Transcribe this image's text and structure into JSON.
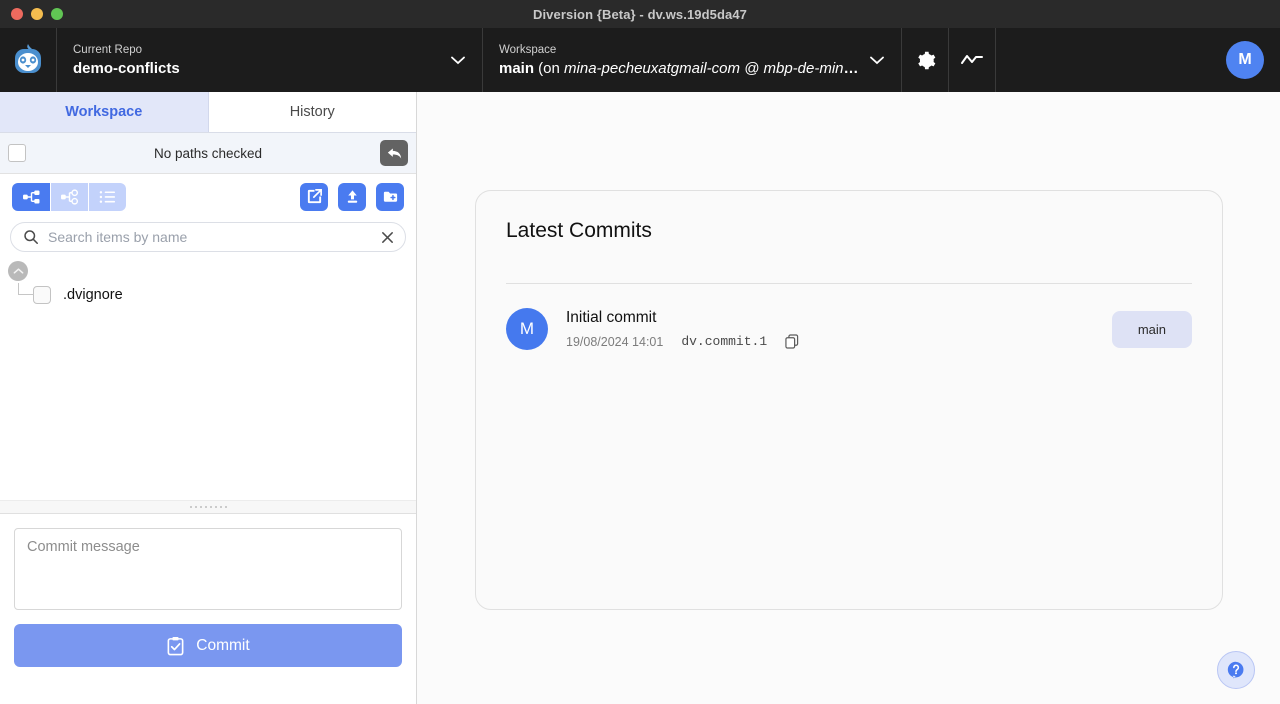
{
  "window": {
    "title": "Diversion {Beta} - dv.ws.19d5da47",
    "traffic_lights": [
      "close",
      "minimize",
      "maximize"
    ]
  },
  "topnav": {
    "logo_icon": "sloth-logo-icon",
    "repo": {
      "label": "Current Repo",
      "value": "demo-conflicts",
      "chevron_icon": "chevron-down-icon"
    },
    "workspace": {
      "label": "Workspace",
      "value_bold": "main",
      "value_rest_prefix": " (on ",
      "value_italic": "mina-pecheuxatgmail-com @ mbp-de-mina-ho",
      "value_rest_suffix": ")",
      "chevron_icon": "chevron-down-icon"
    },
    "settings_icon": "gear-icon",
    "activity_icon": "activity-line-icon",
    "avatar_initial": "M",
    "avatar_color": "#4f83f1"
  },
  "sidebar": {
    "tabs": [
      {
        "label": "Workspace",
        "active": true
      },
      {
        "label": "History",
        "active": false
      }
    ],
    "paths_bar": {
      "checkbox_checked": false,
      "status_text": "No paths checked",
      "revert_icon": "revert-arrow-icon"
    },
    "toolbar": {
      "view_modes": [
        {
          "name": "tree-view",
          "icon": "tree-expanded-icon",
          "active": true
        },
        {
          "name": "tree-changes-view",
          "icon": "tree-changes-icon",
          "active": false
        },
        {
          "name": "list-view",
          "icon": "list-icon",
          "active": false
        }
      ],
      "actions": [
        {
          "name": "open-external-button",
          "icon": "external-link-icon"
        },
        {
          "name": "upload-button",
          "icon": "upload-icon"
        },
        {
          "name": "new-folder-button",
          "icon": "new-folder-icon"
        }
      ]
    },
    "search": {
      "placeholder": "Search items by name",
      "value": "",
      "search_icon": "search-icon",
      "clear_icon": "close-icon"
    },
    "tree": {
      "collapse_icon": "chevron-up-circle-icon",
      "items": [
        {
          "label": ".dvignore",
          "checked": false
        }
      ]
    },
    "commit_panel": {
      "message_placeholder": "Commit message",
      "message_value": "",
      "commit_button_label": "Commit",
      "commit_button_icon": "clipboard-check-icon",
      "commit_button_color": "#7a97f0"
    }
  },
  "main": {
    "card_title": "Latest Commits",
    "commits": [
      {
        "avatar_initial": "M",
        "title": "Initial commit",
        "date": "19/08/2024 14:01",
        "id": "dv.commit.1",
        "copy_icon": "copy-icon",
        "branch": "main"
      }
    ],
    "help_button_icon": "help-question-icon"
  }
}
